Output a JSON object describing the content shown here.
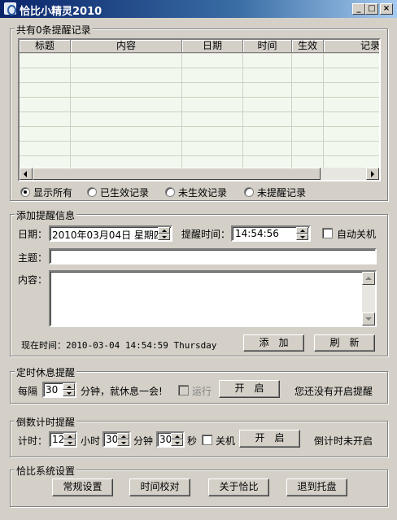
{
  "window": {
    "title": "恰比小精灵2010",
    "minimize": "_",
    "maximize": "□",
    "close": "×"
  },
  "records": {
    "group_title": "共有0条提醒记录",
    "columns": [
      "标题",
      "内容",
      "日期",
      "时间",
      "生效",
      "记录"
    ],
    "rows": [],
    "filters": [
      {
        "label": "显示所有",
        "selected": true
      },
      {
        "label": "已生效记录",
        "selected": false
      },
      {
        "label": "未生效记录",
        "selected": false
      },
      {
        "label": "未提醒记录",
        "selected": false
      }
    ]
  },
  "add": {
    "group_title": "添加提醒信息",
    "date_label": "日期：",
    "date_value": "2010年03月04日 星期四",
    "time_label": "提醒时间：",
    "time_value": "14:54:56",
    "autoshutdown_label": "自动关机",
    "autoshutdown_checked": false,
    "subject_label": "主题：",
    "subject_value": "",
    "content_label": "内容：",
    "content_value": "",
    "now_text": "现在时间：2010-03-04 14:54:59 Thursday",
    "add_button": "添　加",
    "refresh_button": "刷　新"
  },
  "rest": {
    "group_title": "定时休息提醒",
    "every_label": "每隔",
    "minutes_value": "30",
    "msg": "分钟，就休息一会!",
    "run_label": "运行",
    "run_checked": false,
    "start_button": "开　启",
    "status": "您还没有开启提醒"
  },
  "countdown": {
    "group_title": "倒数计时提醒",
    "timer_label": "计时：",
    "hours_value": "12",
    "hours_label": "小时",
    "minutes_value": "30",
    "minutes_label": "分钟",
    "seconds_value": "30",
    "seconds_label": "秒",
    "shutdown_label": "关机",
    "shutdown_checked": false,
    "start_button": "开　启",
    "status": "倒计时未开启"
  },
  "settings": {
    "group_title": "恰比系统设置",
    "buttons": [
      "常规设置",
      "时间校对",
      "关于恰比",
      "退到托盘"
    ]
  }
}
